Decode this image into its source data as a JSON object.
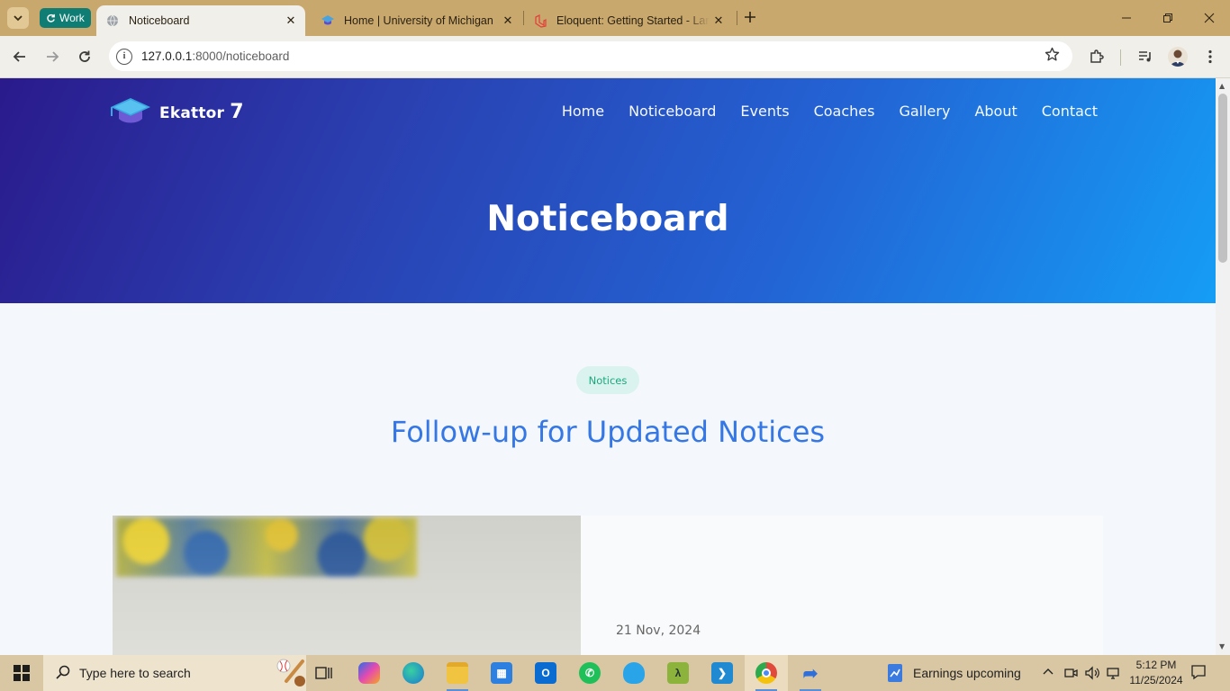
{
  "browser": {
    "tab_search_icon": "chevron-down",
    "profile_group": "Work",
    "tabs": [
      {
        "title": "Noticeboard",
        "icon": "globe-icon",
        "active": true
      },
      {
        "title": "Home | University of Michigan",
        "icon": "graduation-cap-icon",
        "active": false
      },
      {
        "title": "Eloquent: Getting Started - Lara",
        "icon": "laravel-icon",
        "active": false
      }
    ],
    "url_host": "127.0.0.1",
    "url_rest": ":8000/noticeboard"
  },
  "site": {
    "brand": "Ekattor",
    "brand_num": "7",
    "nav": [
      "Home",
      "Noticeboard",
      "Events",
      "Coaches",
      "Gallery",
      "About",
      "Contact"
    ],
    "hero_title": "Noticeboard",
    "badge": "Notices",
    "section_title": "Follow-up for Updated Notices",
    "notices": [
      {
        "date": "21 Nov, 2024"
      }
    ],
    "colors": {
      "hero_start": "#2a1a8c",
      "hero_end": "#159df5",
      "accent": "#3578e5",
      "badge_text": "#19a97c",
      "badge_bg": "#dbf3ee"
    }
  },
  "taskbar": {
    "search_placeholder": "Type here to search",
    "weather_text": "Earnings upcoming",
    "time": "5:12 PM",
    "date": "11/25/2024"
  }
}
